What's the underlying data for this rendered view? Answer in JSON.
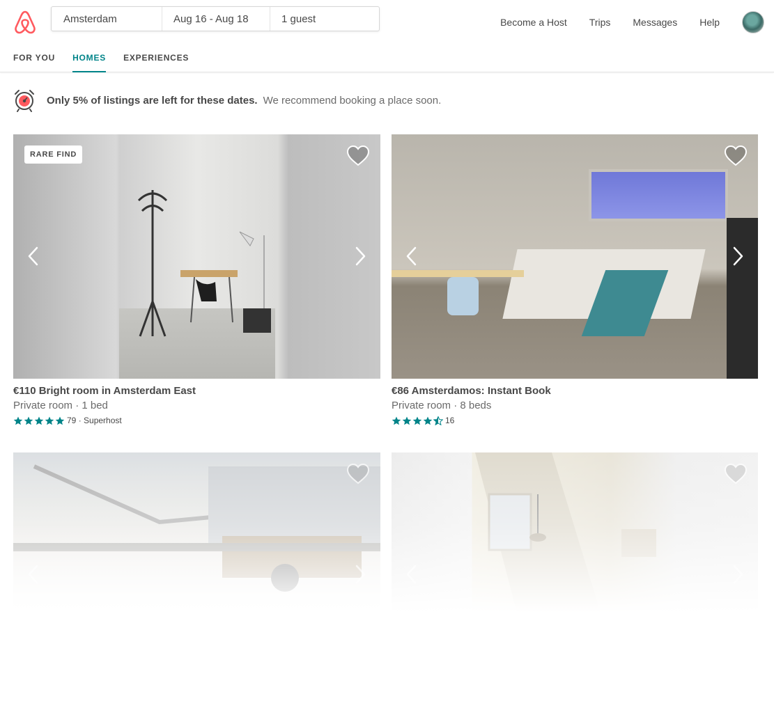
{
  "header": {
    "search": {
      "location": "Amsterdam",
      "dates": "Aug 16 - Aug 18",
      "guests": "1 guest"
    },
    "nav": [
      "Become a Host",
      "Trips",
      "Messages",
      "Help"
    ],
    "brand_color": "#FF5A5F"
  },
  "tabs": [
    {
      "label": "FOR YOU",
      "active": false
    },
    {
      "label": "HOMES",
      "active": true
    },
    {
      "label": "EXPERIENCES",
      "active": false
    }
  ],
  "accent_color": "#008489",
  "banner": {
    "strong": "Only 5% of listings are left for these dates.",
    "text": "We recommend booking a place soon."
  },
  "listings": [
    {
      "badge": "RARE FIND",
      "title": "€110 Bright room in Amsterdam East",
      "subtitle": "Private room · 1 bed",
      "rating": 5,
      "reviews": "79",
      "host_badge": "Superhost"
    },
    {
      "title": "€86 Amsterdamos: Instant Book",
      "subtitle": "Private room · 8 beds",
      "rating": 4.5,
      "reviews": "16"
    },
    {},
    {}
  ]
}
